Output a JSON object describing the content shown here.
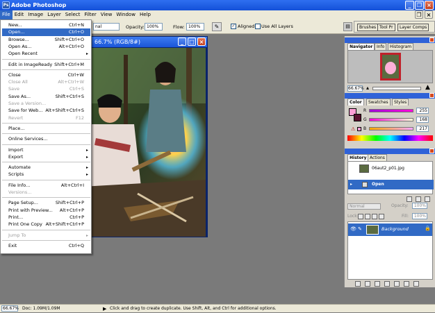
{
  "app": {
    "title": "Adobe Photoshop",
    "logo_text": "Ps"
  },
  "menubar": {
    "items": [
      "File",
      "Edit",
      "Image",
      "Layer",
      "Select",
      "Filter",
      "View",
      "Window",
      "Help"
    ]
  },
  "options": {
    "mode_value": "nal",
    "opacity_label": "Opacity:",
    "opacity_value": "100%",
    "flow_label": "Flow:",
    "flow_value": "100%",
    "aligned_label": "Aligned",
    "aligned_checked": true,
    "all_layers_label": "Use All Layers",
    "all_layers_checked": false,
    "tabs": [
      "Brushes",
      "Tool Pr",
      "Layer Comps"
    ]
  },
  "document": {
    "title": "66.7% (RGB/8#)"
  },
  "file_menu": {
    "items": [
      {
        "label": "New...",
        "shortcut": "Ctrl+N"
      },
      {
        "label": "Open...",
        "shortcut": "Ctrl+O",
        "highlight": true
      },
      {
        "label": "Browse...",
        "shortcut": "Shift+Ctrl+O"
      },
      {
        "label": "Open As...",
        "shortcut": "Alt+Ctrl+O"
      },
      {
        "label": "Open Recent",
        "submenu": true
      },
      {
        "sep": true
      },
      {
        "label": "Edit in ImageReady",
        "shortcut": "Shift+Ctrl+M"
      },
      {
        "sep": true
      },
      {
        "label": "Close",
        "shortcut": "Ctrl+W"
      },
      {
        "label": "Close All",
        "shortcut": "Alt+Ctrl+W",
        "disabled": true
      },
      {
        "label": "Save",
        "shortcut": "Ctrl+S",
        "disabled": true
      },
      {
        "label": "Save As...",
        "shortcut": "Shift+Ctrl+S"
      },
      {
        "label": "Save a Version...",
        "disabled": true
      },
      {
        "label": "Save for Web...",
        "shortcut": "Alt+Shift+Ctrl+S"
      },
      {
        "label": "Revert",
        "shortcut": "F12",
        "disabled": true
      },
      {
        "sep": true
      },
      {
        "label": "Place..."
      },
      {
        "sep": true
      },
      {
        "label": "Online Services..."
      },
      {
        "sep": true
      },
      {
        "label": "Import",
        "submenu": true
      },
      {
        "label": "Export",
        "submenu": true
      },
      {
        "sep": true
      },
      {
        "label": "Automate",
        "submenu": true
      },
      {
        "label": "Scripts",
        "submenu": true
      },
      {
        "sep": true
      },
      {
        "label": "File Info...",
        "shortcut": "Alt+Ctrl+I"
      },
      {
        "label": "Versions...",
        "disabled": true
      },
      {
        "sep": true
      },
      {
        "label": "Page Setup...",
        "shortcut": "Shift+Ctrl+P"
      },
      {
        "label": "Print with Preview...",
        "shortcut": "Alt+Ctrl+P"
      },
      {
        "label": "Print...",
        "shortcut": "Ctrl+P"
      },
      {
        "label": "Print One Copy",
        "shortcut": "Alt+Shift+Ctrl+P"
      },
      {
        "sep": true
      },
      {
        "label": "Jump To",
        "submenu": true,
        "disabled": true
      },
      {
        "sep": true
      },
      {
        "label": "Exit",
        "shortcut": "Ctrl+Q"
      }
    ]
  },
  "navigator": {
    "tabs": [
      "Navigator",
      "Info",
      "Histogram"
    ],
    "zoom": "66.67%"
  },
  "color": {
    "tabs": [
      "Color",
      "Swatches",
      "Styles"
    ],
    "r": "255",
    "g": "168",
    "b": "217",
    "r_label": "R",
    "g_label": "G",
    "b_label": "B"
  },
  "history": {
    "tabs": [
      "History",
      "Actions"
    ],
    "items": [
      "06aut2_p01.jpg",
      "Open"
    ]
  },
  "layers": {
    "mode": "Normal",
    "opacity_label": "Opacity:",
    "opacity_value": "100%",
    "lock_label": "Lock:",
    "fill_label": "Fill:",
    "fill_value": "100%",
    "layer_name": "Background"
  },
  "status": {
    "zoom": "66.67%",
    "doc": "Doc: 1.09M/1.09M",
    "hint": "Click and drag to create duplicate. Use Shift, Alt, and Ctrl for additional options."
  },
  "colors": {
    "accent": "#316ac5",
    "title": "#1350d8",
    "fg_swatch": "#ff9fd6",
    "bg_swatch": "#5a1030"
  }
}
